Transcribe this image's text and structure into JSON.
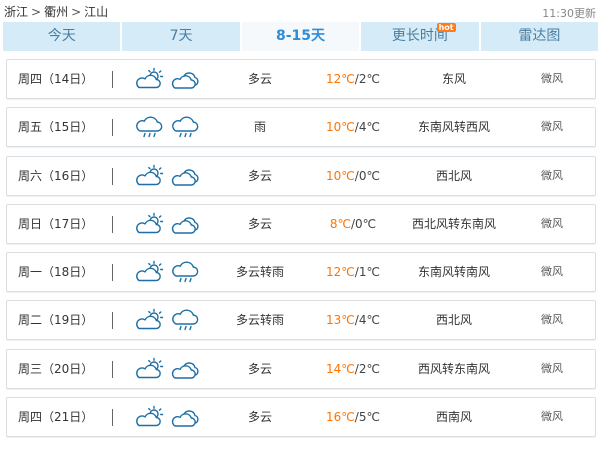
{
  "breadcrumb": {
    "province": "浙江",
    "city": "衢州",
    "county": "江山",
    "separator": ">"
  },
  "updated": "11:30更新",
  "tabs": [
    {
      "label": "今天",
      "active": false
    },
    {
      "label": "7天",
      "active": false
    },
    {
      "label": "8-15天",
      "active": true
    },
    {
      "label": "更长时间",
      "active": false,
      "badge": "hot"
    },
    {
      "label": "雷达图",
      "active": false
    }
  ],
  "colors": {
    "tab_bg": "#d5ebf7",
    "tab_active_text": "#2d8ed6",
    "high_temp": "#ff7300",
    "icon_stroke": "#1d6fa5"
  },
  "forecast": [
    {
      "day": "周四（14日）",
      "icons": [
        "partly-cloudy-icon",
        "cloudy-icon"
      ],
      "weather": "多云",
      "high": "12℃",
      "low": "2℃",
      "wind": "东风",
      "wind_level": "微风"
    },
    {
      "day": "周五（15日）",
      "icons": [
        "rain-icon",
        "rain-icon"
      ],
      "weather": "雨",
      "high": "10℃",
      "low": "4℃",
      "wind": "东南风转西风",
      "wind_level": "微风"
    },
    {
      "day": "周六（16日）",
      "icons": [
        "partly-cloudy-icon",
        "cloudy-icon"
      ],
      "weather": "多云",
      "high": "10℃",
      "low": "0℃",
      "wind": "西北风",
      "wind_level": "微风"
    },
    {
      "day": "周日（17日）",
      "icons": [
        "partly-cloudy-icon",
        "cloudy-icon"
      ],
      "weather": "多云",
      "high": "8℃",
      "low": "0℃",
      "wind": "西北风转东南风",
      "wind_level": "微风"
    },
    {
      "day": "周一（18日）",
      "icons": [
        "partly-cloudy-icon",
        "rain-icon"
      ],
      "weather": "多云转雨",
      "high": "12℃",
      "low": "1℃",
      "wind": "东南风转南风",
      "wind_level": "微风"
    },
    {
      "day": "周二（19日）",
      "icons": [
        "partly-cloudy-icon",
        "rain-icon"
      ],
      "weather": "多云转雨",
      "high": "13℃",
      "low": "4℃",
      "wind": "西北风",
      "wind_level": "微风"
    },
    {
      "day": "周三（20日）",
      "icons": [
        "partly-cloudy-icon",
        "cloudy-icon"
      ],
      "weather": "多云",
      "high": "14℃",
      "low": "2℃",
      "wind": "西风转东南风",
      "wind_level": "微风"
    },
    {
      "day": "周四（21日）",
      "icons": [
        "partly-cloudy-icon",
        "cloudy-icon"
      ],
      "weather": "多云",
      "high": "16℃",
      "low": "5℃",
      "wind": "西南风",
      "wind_level": "微风"
    }
  ]
}
